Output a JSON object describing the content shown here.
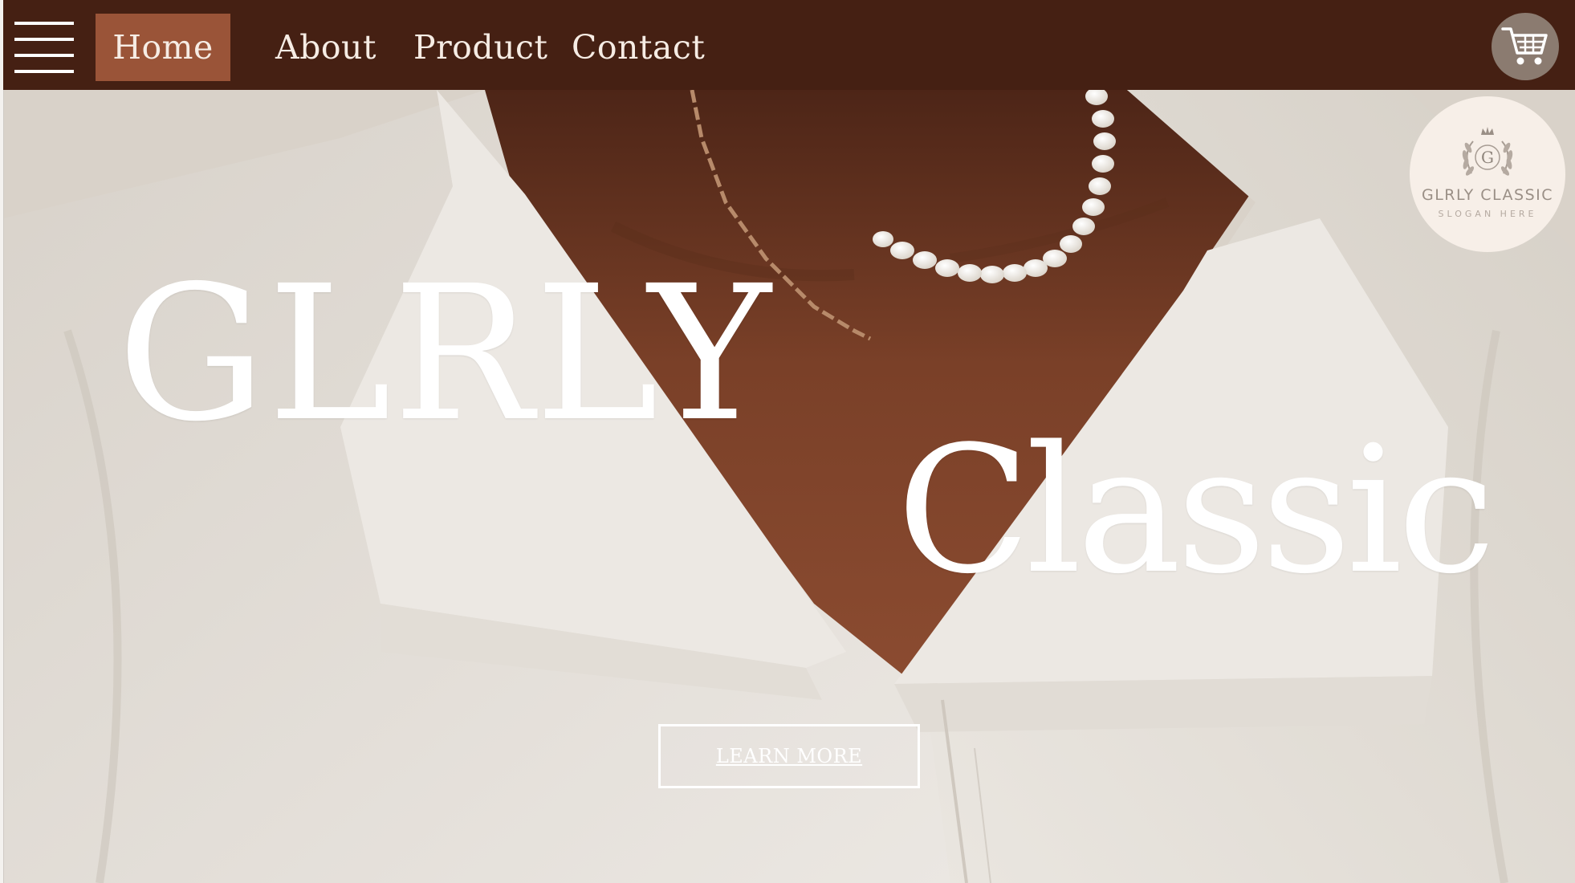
{
  "nav": {
    "items": [
      {
        "label": "Home",
        "active": true
      },
      {
        "label": "About",
        "active": false
      },
      {
        "label": "Product",
        "active": false
      },
      {
        "label": "Contact",
        "active": false
      }
    ],
    "menu_icon": "hamburger-menu-icon",
    "cart_icon": "shopping-cart-icon"
  },
  "hero": {
    "title_line_1": "GLRLY",
    "title_line_2": "Classic",
    "cta_label": "LEARN MORE"
  },
  "logo": {
    "initial": "G",
    "name": "GLRLY CLASSIC",
    "slogan": "SLOGAN HERE",
    "icon": "crown-laurel-emblem-icon"
  },
  "colors": {
    "nav_background": "#452013",
    "nav_active": "#9a5438",
    "cart_button": "#8b7b70",
    "logo_badge": "#f7efe8",
    "text_light": "#ffffff"
  }
}
